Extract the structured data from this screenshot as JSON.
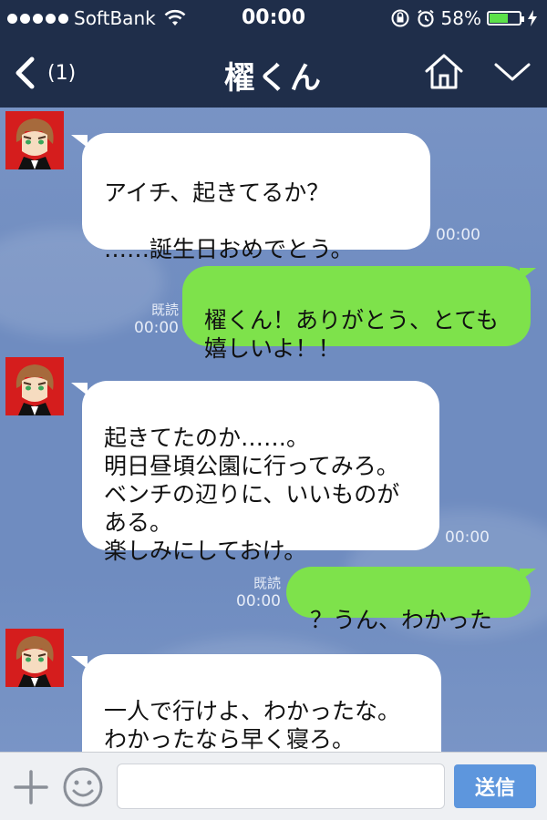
{
  "status_bar": {
    "carrier": "SoftBank",
    "time": "00:00",
    "battery_percent": "58%",
    "battery_level": 0.58
  },
  "nav": {
    "back_count": "(1)",
    "title": "櫂くん"
  },
  "messages": [
    {
      "side": "in",
      "text": "アイチ、起きてるか？\n\n……誕生日おめでとう。",
      "time": "00:00"
    },
    {
      "side": "out",
      "text": "櫂くん！ありがとう、とても嬉しいよ！！",
      "time": "00:00",
      "read": "既読"
    },
    {
      "side": "in",
      "text": "起きてたのか……。\n明日昼頃公園に行ってみろ。\nベンチの辺りに、いいものがある。\n楽しみにしておけ。",
      "time": "00:00"
    },
    {
      "side": "out",
      "text": "？うん、わかった",
      "time": "00:00",
      "read": "既読"
    },
    {
      "side": "in",
      "text": "一人で行けよ、わかったな。\nわかったなら早く寝ろ。\n起きられなくなるぞ。",
      "time": ""
    }
  ],
  "input_bar": {
    "placeholder": "",
    "send_label": "送信"
  },
  "colors": {
    "header": "#1f2e4a",
    "incoming_bubble": "#ffffff",
    "outgoing_bubble": "#7ee24b",
    "send_button": "#5d96dd"
  },
  "icons": [
    "wifi-icon",
    "lock-rotation-icon",
    "alarm-icon",
    "battery-icon",
    "charging-icon",
    "back-chevron-icon",
    "home-icon",
    "chevron-down-icon",
    "plus-icon",
    "emoji-icon"
  ]
}
